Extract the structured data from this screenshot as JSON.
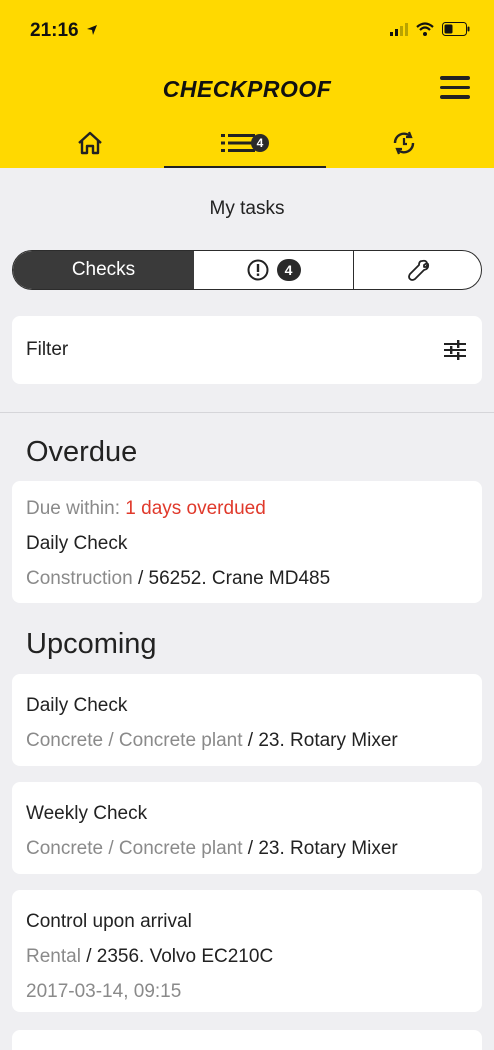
{
  "status_bar": {
    "time": "21:16"
  },
  "header": {
    "logo": "CHECKPROOF"
  },
  "nav": {
    "tasks_badge": "4"
  },
  "page_title": "My tasks",
  "segments": {
    "checks": "Checks",
    "issues_badge": "4"
  },
  "filter": {
    "label": "Filter"
  },
  "overdue": {
    "title": "Overdue",
    "cards": [
      {
        "due_label": "Due within:",
        "due_value": "1 days overdued",
        "name": "Daily Check",
        "path_muted": "Construction",
        "path_sep": " / ",
        "path_dark": "56252. Crane MD485"
      }
    ]
  },
  "upcoming": {
    "title": "Upcoming",
    "cards": [
      {
        "name": "Daily Check",
        "path_muted": "Concrete / Concrete plant",
        "path_sep": " / ",
        "path_dark": "23. Rotary Mixer"
      },
      {
        "name": "Weekly Check",
        "path_muted": "Concrete / Concrete plant",
        "path_sep": " / ",
        "path_dark": "23. Rotary Mixer"
      },
      {
        "name": "Control upon arrival",
        "path_muted": "Rental",
        "path_sep": " / ",
        "path_dark": "2356. Volvo EC210C",
        "datetime": "2017-03-14, 09:15"
      }
    ]
  },
  "colors": {
    "header": "#ffd900",
    "overdue": "#e0392b"
  }
}
